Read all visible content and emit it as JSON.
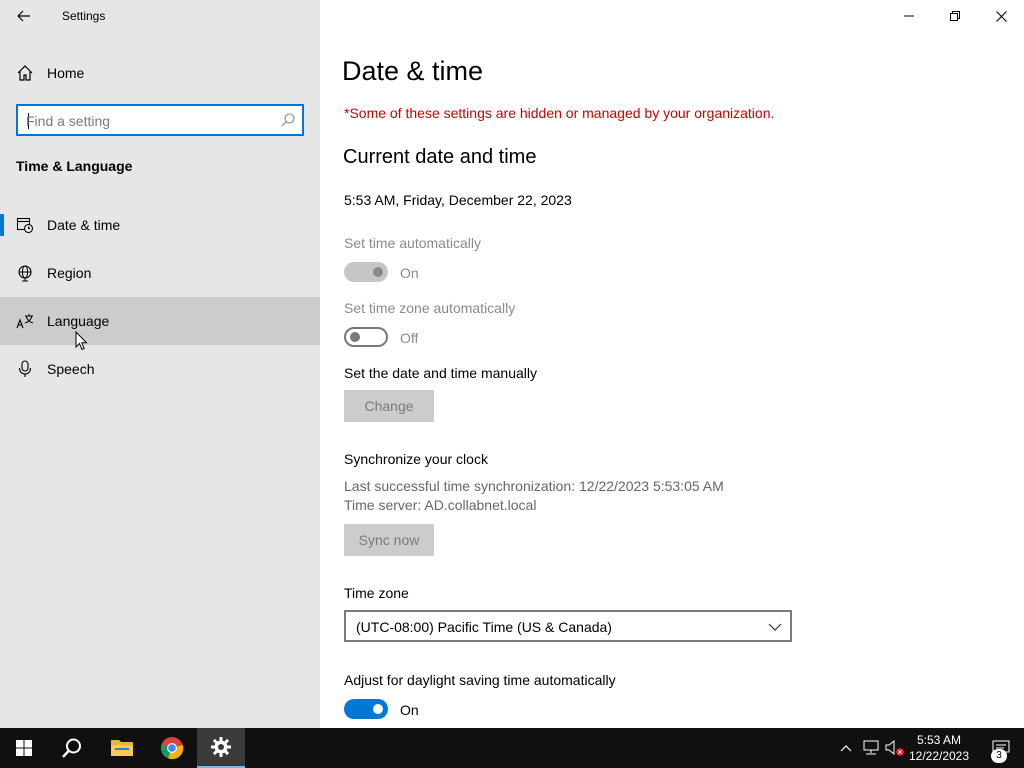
{
  "window": {
    "app_title": "Settings"
  },
  "sidebar": {
    "home_label": "Home",
    "search_placeholder": "Find a setting",
    "section_title": "Time & Language",
    "items": [
      {
        "label": "Date & time",
        "icon": "date-time-icon",
        "active": true
      },
      {
        "label": "Region",
        "icon": "globe-icon",
        "active": false
      },
      {
        "label": "Language",
        "icon": "language-icon",
        "active": false,
        "hover": true
      },
      {
        "label": "Speech",
        "icon": "microphone-icon",
        "active": false
      }
    ]
  },
  "main": {
    "page_title": "Date & time",
    "org_warning": "*Some of these settings are hidden or managed by your organization.",
    "current_heading": "Current date and time",
    "current_time": "5:53 AM, Friday, December 22, 2023",
    "set_time_auto": {
      "label": "Set time automatically",
      "state": "On"
    },
    "set_tz_auto": {
      "label": "Set time zone automatically",
      "state": "Off"
    },
    "manual": {
      "label": "Set the date and time manually",
      "button": "Change"
    },
    "sync": {
      "heading": "Synchronize your clock",
      "last_sync": "Last successful time synchronization: 12/22/2023 5:53:05 AM",
      "server": "Time server: AD.collabnet.local",
      "button": "Sync now"
    },
    "timezone": {
      "label": "Time zone",
      "value": "(UTC-08:00) Pacific Time (US & Canada)"
    },
    "dst": {
      "label": "Adjust for daylight saving time automatically",
      "state": "On"
    }
  },
  "taskbar": {
    "clock_time": "5:53 AM",
    "clock_date": "12/22/2023",
    "notification_count": "3"
  },
  "colors": {
    "accent": "#0078d7",
    "warning": "#c50500",
    "sidebar_bg": "#e6e6e6"
  }
}
